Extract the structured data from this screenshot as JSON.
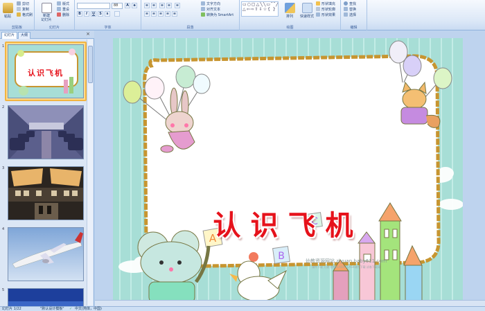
{
  "ribbon": {
    "clipboard": {
      "paste": "粘贴",
      "cut": "剪切",
      "copy": "复制",
      "format_painter": "格式刷",
      "label": "剪贴板"
    },
    "slides": {
      "new_slide": "新建\n幻灯片",
      "layout": "版式",
      "reset": "重设",
      "delete": "删除",
      "label": "幻灯片"
    },
    "font": {
      "size": "88",
      "label": "字体"
    },
    "paragraph": {
      "text_direction": "文字方向",
      "align_text": "对齐文本",
      "smartart": "转换为 SmartArt",
      "label": "段落"
    },
    "drawing": {
      "arrange": "排列",
      "quick_styles": "快速样式",
      "shape_fill": "形状填充",
      "shape_outline": "形状轮廓",
      "shape_effects": "形状效果",
      "label": "绘图"
    },
    "editing": {
      "find": "查找",
      "replace": "替换",
      "select": "选择",
      "label": "编辑"
    }
  },
  "panel": {
    "tabs": [
      "幻灯片",
      "大纲"
    ],
    "close": "×",
    "slide_numbers": [
      "1",
      "2",
      "3",
      "4",
      "5"
    ],
    "thumb1_title": "认识飞机"
  },
  "slide": {
    "title": "认识飞机",
    "watermark": "幼教资源网站 ziyuan.baby611.com",
    "watermark_sub": "课件下载  儿歌  视频FLASH  FLASH课件下载  试卷下载网",
    "letters": [
      "A",
      "B",
      "C"
    ]
  },
  "status": {
    "slide_counter": "幻灯片 1/22",
    "theme": "\"默认设计模板\"",
    "language": "中文(简体，中国)"
  },
  "colors": {
    "title_red": "#e6121b",
    "slide_bg": "#a7ded6",
    "frame": "#c79530",
    "ribbon": "#dce8f7"
  }
}
